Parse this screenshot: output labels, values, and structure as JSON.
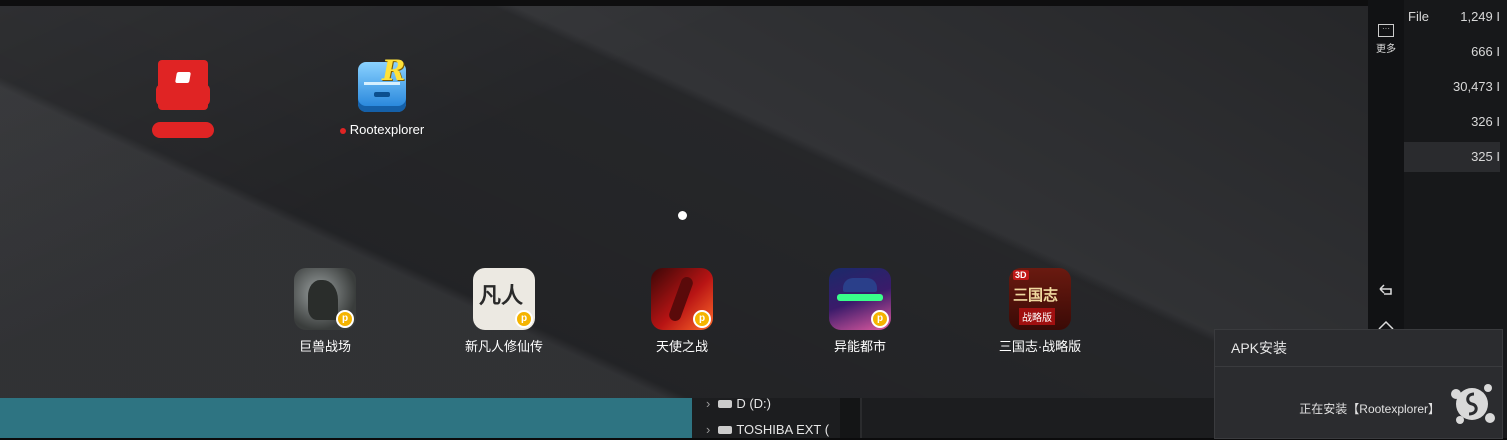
{
  "launcher": {
    "top_apps": [
      {
        "label": "",
        "icon": "red-app-icon"
      },
      {
        "label": "Rootexplorer",
        "icon": "root-explorer-icon"
      }
    ],
    "dock_apps": [
      {
        "label": "巨兽战场",
        "icon": "giant-beast-game-icon"
      },
      {
        "label": "新凡人修仙传",
        "icon": "mortal-cultivation-game-icon",
        "glyph": "凡人"
      },
      {
        "label": "天使之战",
        "icon": "angel-war-game-icon"
      },
      {
        "label": "异能都市",
        "icon": "superpower-city-game-icon"
      },
      {
        "label": "三国志·战略版",
        "icon": "three-kingdoms-game-icon",
        "glyph": "三国志",
        "sub": "战略版",
        "tag": "3D"
      }
    ]
  },
  "sidebar": {
    "more_label": "更多"
  },
  "file_panel": {
    "header": "File",
    "rows": [
      "1,249 I",
      "666 I",
      "30,473 I",
      "326 I",
      "325 I"
    ]
  },
  "drives": [
    {
      "label": "D (D:)"
    },
    {
      "label": "TOSHIBA EXT ("
    }
  ],
  "apk_dialog": {
    "title": "APK安装",
    "message": "正在安装【Rootexplorer】"
  },
  "colors": {
    "teal": "#2e7482",
    "red_icon": "#e02424",
    "badge": "#f5b400"
  }
}
